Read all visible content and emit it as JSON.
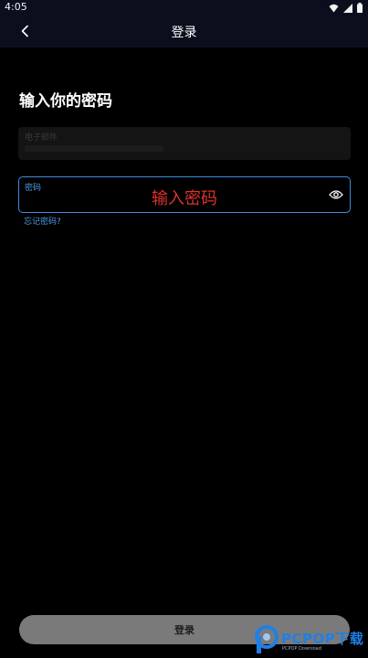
{
  "status_bar": {
    "time": "4:05"
  },
  "app_bar": {
    "title": "登录"
  },
  "heading": "输入你的密码",
  "email_field": {
    "label": "电子邮件"
  },
  "password_field": {
    "label": "密码",
    "value": "",
    "overlay_text": "输入密码"
  },
  "forgot_password": "忘记密码?",
  "login_button": "登录",
  "watermark": {
    "text": "PCPOP下载",
    "subtext": "PCPOP Download"
  },
  "icons": {
    "back": "chevron-left-icon",
    "visibility": "eye-icon",
    "wifi": "wifi-icon",
    "signal": "signal-icon",
    "battery": "battery-icon"
  },
  "colors": {
    "accent": "#3f8ce0",
    "overlay_red": "#e0312c",
    "app_bar": "#0b0f1d",
    "button": "#7a7a7a",
    "watermark": "#1f7fe6"
  }
}
